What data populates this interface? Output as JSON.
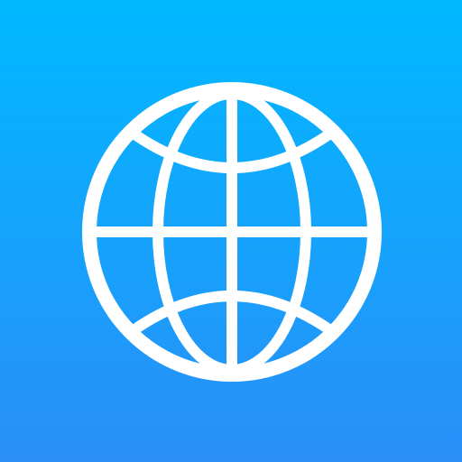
{
  "icon": {
    "name": "globe-icon",
    "background_top_color": "#00B9FF",
    "background_bottom_color": "#2A8EF9",
    "glyph_color": "#FFFFFF"
  }
}
